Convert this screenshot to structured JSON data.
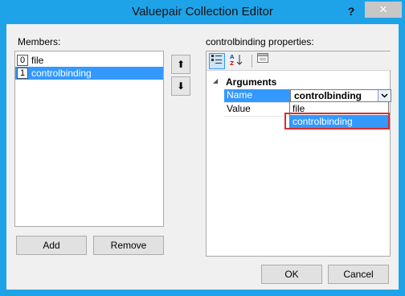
{
  "window": {
    "title": "Valuepair Collection Editor",
    "help_label": "?",
    "close_label": "✕"
  },
  "members": {
    "label": "Members:",
    "items": [
      {
        "index": "0",
        "name": "file"
      },
      {
        "index": "1",
        "name": "controlbinding",
        "selected": true
      }
    ],
    "move_up_label": "⬆",
    "move_down_label": "⬇",
    "add_label": "Add",
    "remove_label": "Remove"
  },
  "properties": {
    "label": "controlbinding properties:",
    "toolbar": {
      "categorized_icon": "categorized-icon",
      "alphabetical_icon": "alphabetical-icon",
      "property_pages_icon": "property-pages-icon"
    },
    "category": "Arguments",
    "rows": [
      {
        "name": "Name",
        "value": "controlbinding"
      },
      {
        "name": "Value",
        "value": ""
      }
    ],
    "dropdown_options": [
      "file",
      "controlbinding"
    ]
  },
  "footer": {
    "ok_label": "OK",
    "cancel_label": "Cancel"
  },
  "colors": {
    "title_bar": "#1fa3e8",
    "selection": "#3399ff",
    "highlight_box": "#d32f2f"
  }
}
